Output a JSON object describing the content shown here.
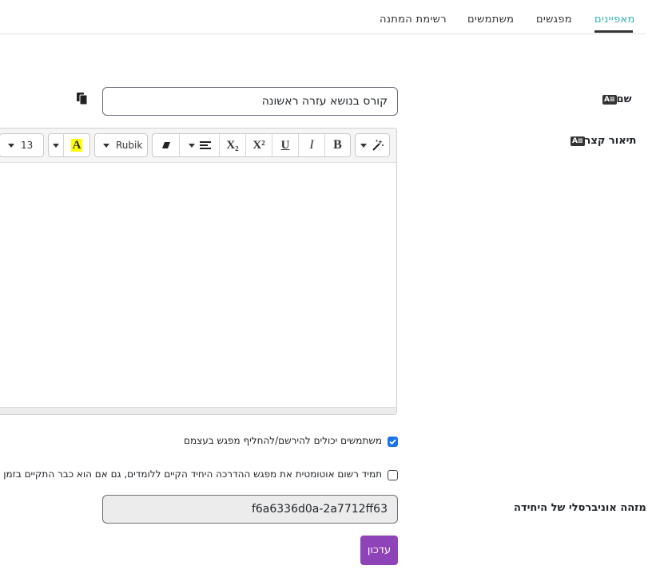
{
  "tabs": [
    {
      "label": "מאפיינים",
      "active": true
    },
    {
      "label": "מפגשים"
    },
    {
      "label": "משתמשים"
    },
    {
      "label": "רשימת המתנה"
    }
  ],
  "name_field": {
    "label": "שם",
    "badge": "A≡",
    "value": "קורס בנושא עזרה ראשונה"
  },
  "description_field": {
    "label": "תיאור קצר",
    "badge": "A≡"
  },
  "editor_toolbar": {
    "font_name": "Rubik",
    "font_size": "13",
    "bold": "B",
    "italic": "I",
    "underline": "U",
    "superscript": "X²",
    "subscript": "X₂",
    "highlight": "A"
  },
  "checkboxes": [
    {
      "label": "משתמשים יכולים להירשם/להחליף מפגש בעצמם",
      "checked": true
    },
    {
      "label": "תמיד רשום אוטומטית את מפגש ההדרכה היחיד הקיים ללומדים, גם אם הוא כבר התקיים בזמן",
      "checked": false
    }
  ],
  "uuid_field": {
    "label": "מזהה אוניברסלי של היחידה",
    "value": "f6a6336d0a-2a7712ff63"
  },
  "update_button": {
    "label": "עדכון"
  },
  "colors": {
    "accent_tab": "#2bb3b3",
    "update_button": "#8e44b8",
    "checkbox": "#1a73e8",
    "highlight": "#ffff00"
  }
}
